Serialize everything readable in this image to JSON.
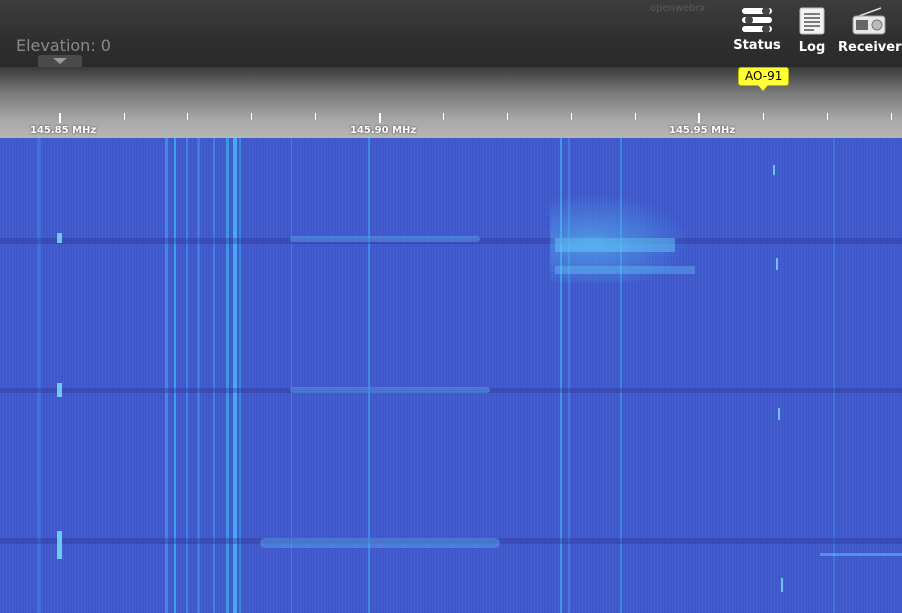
{
  "elevation": {
    "label": "Elevation: 0"
  },
  "faint_toolbar": {
    "items": [
      "openwebrx",
      "",
      ""
    ]
  },
  "nav": {
    "status_label": "Status",
    "log_label": "Log",
    "receiver_label": "Receiver"
  },
  "satellite": {
    "label": "AO-91"
  },
  "scale": {
    "labels": [
      "145.85 MHz",
      "145.90 MHz",
      "145.95 MHz"
    ]
  },
  "colors": {
    "waterfall_bg": "#3f5ad4",
    "signal": "#37b8f0",
    "satellite_label_bg": "#ffff33",
    "header_bg": "#333333"
  }
}
